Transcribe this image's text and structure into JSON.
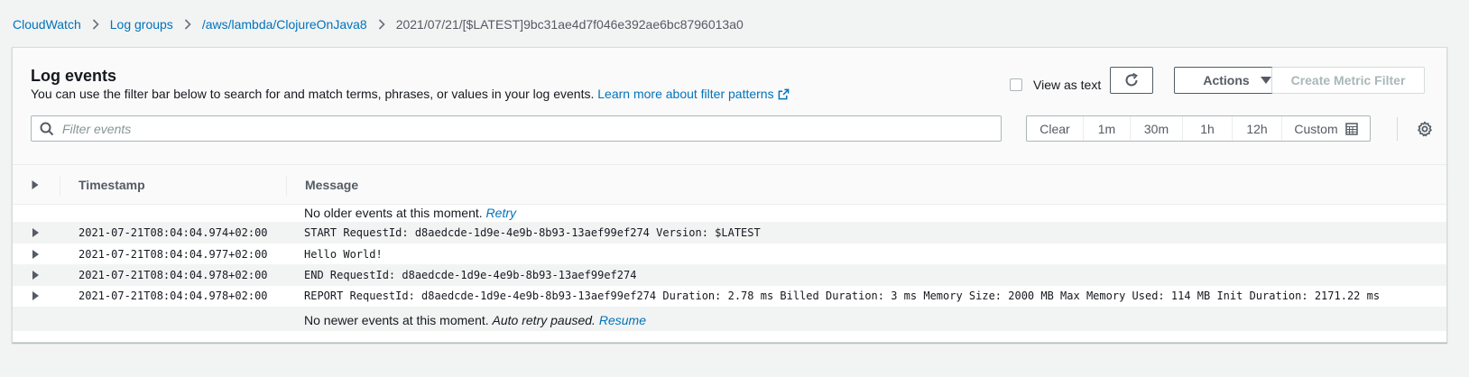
{
  "breadcrumb": {
    "items": [
      "CloudWatch",
      "Log groups",
      "/aws/lambda/ClojureOnJava8"
    ],
    "current": "2021/07/21/[$LATEST]9bc31ae4d7f046e392ae6bc8796013a0"
  },
  "header": {
    "title": "Log events",
    "description": "You can use the filter bar below to search for and match terms, phrases, or values in your log events.",
    "learn_more": "Learn more about filter patterns"
  },
  "toolbar": {
    "view_as_text": "View as text",
    "actions_label": "Actions",
    "create_metric_filter": "Create Metric Filter"
  },
  "search": {
    "placeholder": "Filter events"
  },
  "time_range": {
    "items": [
      "Clear",
      "1m",
      "30m",
      "1h",
      "12h"
    ],
    "custom": "Custom"
  },
  "table": {
    "columns": {
      "timestamp": "Timestamp",
      "message": "Message"
    },
    "top_notice": {
      "text": "No older events at this moment.",
      "retry": "Retry"
    },
    "rows": [
      {
        "timestamp": "2021-07-21T08:04:04.974+02:00",
        "message": "START RequestId: d8aedcde-1d9e-4e9b-8b93-13aef99ef274 Version: $LATEST"
      },
      {
        "timestamp": "2021-07-21T08:04:04.977+02:00",
        "message": "Hello World!"
      },
      {
        "timestamp": "2021-07-21T08:04:04.978+02:00",
        "message": "END RequestId: d8aedcde-1d9e-4e9b-8b93-13aef99ef274"
      },
      {
        "timestamp": "2021-07-21T08:04:04.978+02:00",
        "message": "REPORT RequestId: d8aedcde-1d9e-4e9b-8b93-13aef99ef274 Duration: 2.78 ms Billed Duration: 3 ms Memory Size: 2000 MB Max Memory Used: 114 MB Init Duration: 2171.22 ms"
      }
    ],
    "bottom_notice": {
      "text": "No newer events at this moment.",
      "paused": "Auto retry paused.",
      "resume": "Resume"
    }
  },
  "colors": {
    "link": "#0073bb",
    "row_shade": "#f2f3f3",
    "text": "#16191f",
    "muted": "#545b64"
  },
  "icons": [
    "chevron-right-icon",
    "external-link-icon",
    "refresh-icon",
    "caret-down-icon",
    "search-icon",
    "calendar-icon",
    "gear-icon",
    "expand-icon"
  ]
}
